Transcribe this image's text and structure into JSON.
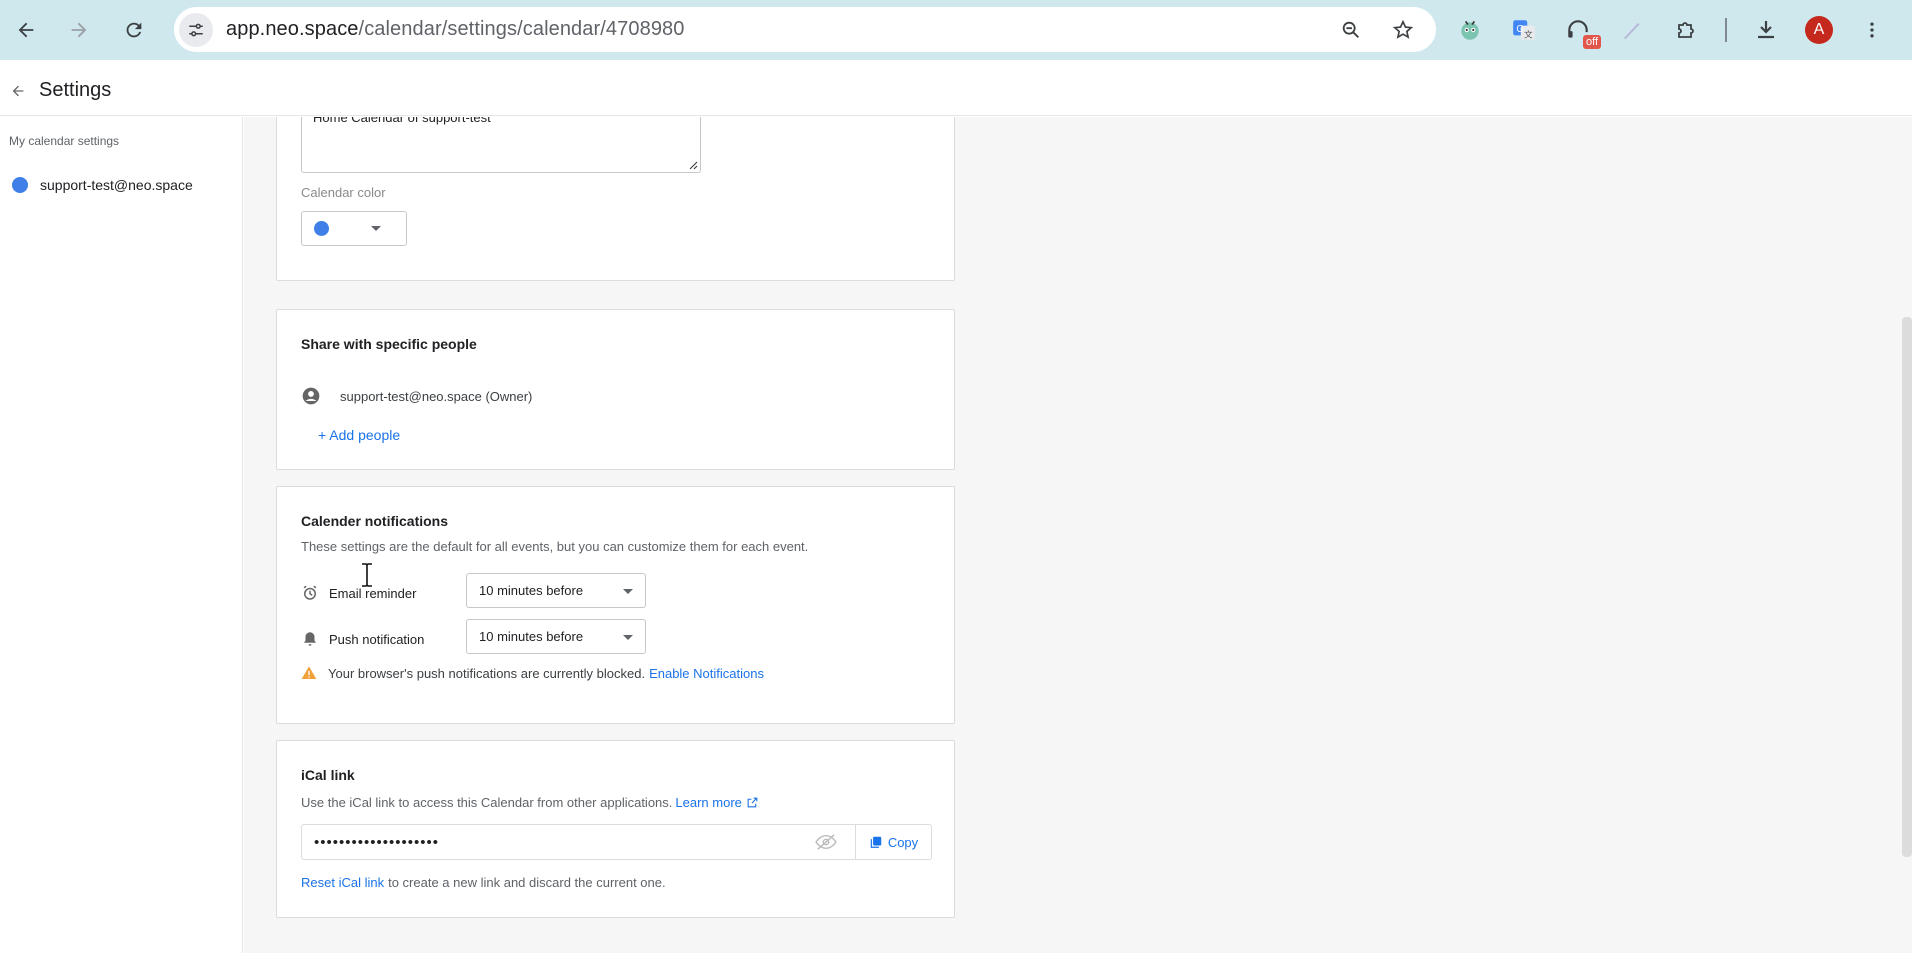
{
  "browser": {
    "url_host": "app.neo.space",
    "url_path": "/calendar/settings/calendar/4708980",
    "extension_badge": "off",
    "profile_initial": "A"
  },
  "header": {
    "title": "Settings"
  },
  "sidebar": {
    "heading": "My calendar settings",
    "items": [
      {
        "label": "support-test@neo.space",
        "color": "#3f7fe8"
      }
    ]
  },
  "calendar_details": {
    "description_value": "Home Calendar of support-test",
    "color_label": "Calendar color",
    "selected_color": "#3f7fe8"
  },
  "sharing": {
    "title": "Share with specific people",
    "people": [
      {
        "label": "support-test@neo.space (Owner)"
      }
    ],
    "add_people_label": "+ Add people"
  },
  "notifications": {
    "title": "Calender notifications",
    "description": "These settings are the default for all events, but you can customize them for each event.",
    "email_label": "Email reminder",
    "email_value": "10 minutes before",
    "push_label": "Push notification",
    "push_value": "10 minutes before",
    "warning_text": "Your browser's push notifications are currently blocked.",
    "enable_link": "Enable Notifications"
  },
  "ical": {
    "title": "iCal link",
    "description": "Use the iCal link to access this Calendar from other applications.",
    "learn_more": "Learn more",
    "masked_value": "••••••••••••••••••••",
    "copy_label": "Copy",
    "reset_link": "Reset iCal link",
    "reset_suffix": "to create a new link and discard the current one."
  }
}
